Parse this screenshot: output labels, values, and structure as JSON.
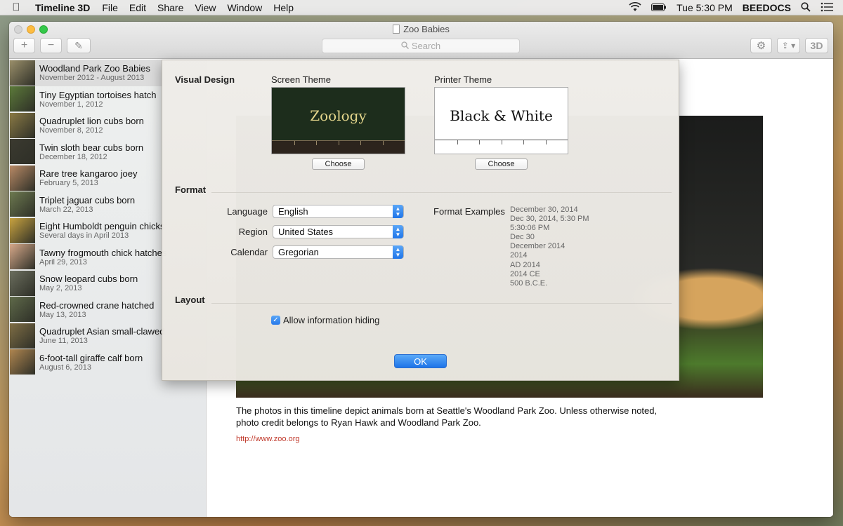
{
  "menubar": {
    "app_name": "Timeline 3D",
    "items": [
      "File",
      "Edit",
      "Share",
      "View",
      "Window",
      "Help"
    ],
    "clock": "Tue 5:30 PM",
    "user": "BEEDOCS"
  },
  "window": {
    "title": "Zoo Babies",
    "search_placeholder": "Search",
    "toolbar": {
      "add_label": "+",
      "remove_label": "−",
      "edit_label": "✎",
      "settings_label": "⚙",
      "share_label": "⇪ ▾",
      "three_d_label": "3D"
    }
  },
  "sidebar": {
    "items": [
      {
        "title": "Woodland Park Zoo Babies",
        "date": "November 2012 - August 2013",
        "thumb_color": "#9a8f6a"
      },
      {
        "title": "Tiny Egyptian tortoises hatch",
        "date": "November 1, 2012",
        "thumb_color": "#5c7a3a"
      },
      {
        "title": "Quadruplet lion cubs born",
        "date": "November 8, 2012",
        "thumb_color": "#8a7a45"
      },
      {
        "title": "Twin sloth bear cubs born",
        "date": "December 18, 2012",
        "thumb_color": "#3b3a30"
      },
      {
        "title": "Rare tree kangaroo joey",
        "date": "February 5, 2013",
        "thumb_color": "#b98a66"
      },
      {
        "title": "Triplet jaguar cubs born",
        "date": "March 22, 2013",
        "thumb_color": "#6d7a50"
      },
      {
        "title": "Eight Humboldt penguin chicks",
        "date": "Several days in April 2013",
        "thumb_color": "#c9a340"
      },
      {
        "title": "Tawny frogmouth chick hatches",
        "date": "April 29, 2013",
        "thumb_color": "#d7a98a"
      },
      {
        "title": "Snow leopard cubs born",
        "date": "May 2, 2013",
        "thumb_color": "#6b6e5e"
      },
      {
        "title": "Red-crowned crane hatched",
        "date": "May 13, 2013",
        "thumb_color": "#5f6a4a"
      },
      {
        "title": "Quadruplet Asian small-clawed",
        "date": "June 11, 2013",
        "thumb_color": "#7f6e45"
      },
      {
        "title": "6-foot-tall giraffe calf born",
        "date": "August 6, 2013",
        "thumb_color": "#b08650"
      }
    ]
  },
  "content": {
    "description": "The photos in this timeline depict animals born at Seattle's Woodland Park Zoo. Unless otherwise noted, photo credit belongs to Ryan Hawk and Woodland Park Zoo.",
    "link": "http://www.zoo.org"
  },
  "dialog": {
    "visual_design_label": "Visual Design",
    "screen_theme_label": "Screen Theme",
    "screen_theme_name": "Zoology",
    "printer_theme_label": "Printer Theme",
    "printer_theme_name": "Black & White",
    "choose_label": "Choose",
    "format_label": "Format",
    "language_label": "Language",
    "language_value": "English",
    "region_label": "Region",
    "region_value": "United States",
    "calendar_label": "Calendar",
    "calendar_value": "Gregorian",
    "format_examples_label": "Format Examples",
    "format_examples": [
      "December 30, 2014",
      "Dec 30, 2014, 5:30 PM",
      "5:30:06 PM",
      "Dec 30",
      "December 2014",
      "2014",
      "AD 2014",
      "2014 CE",
      "500 B.C.E."
    ],
    "layout_label": "Layout",
    "allow_hiding_label": "Allow information hiding",
    "allow_hiding_checked": true,
    "ok_label": "OK"
  },
  "colors": {
    "accent": "#2779ea",
    "link": "#c0392b",
    "screen_theme_bg": "#1d2d1c",
    "screen_theme_text": "#e3d58b"
  }
}
